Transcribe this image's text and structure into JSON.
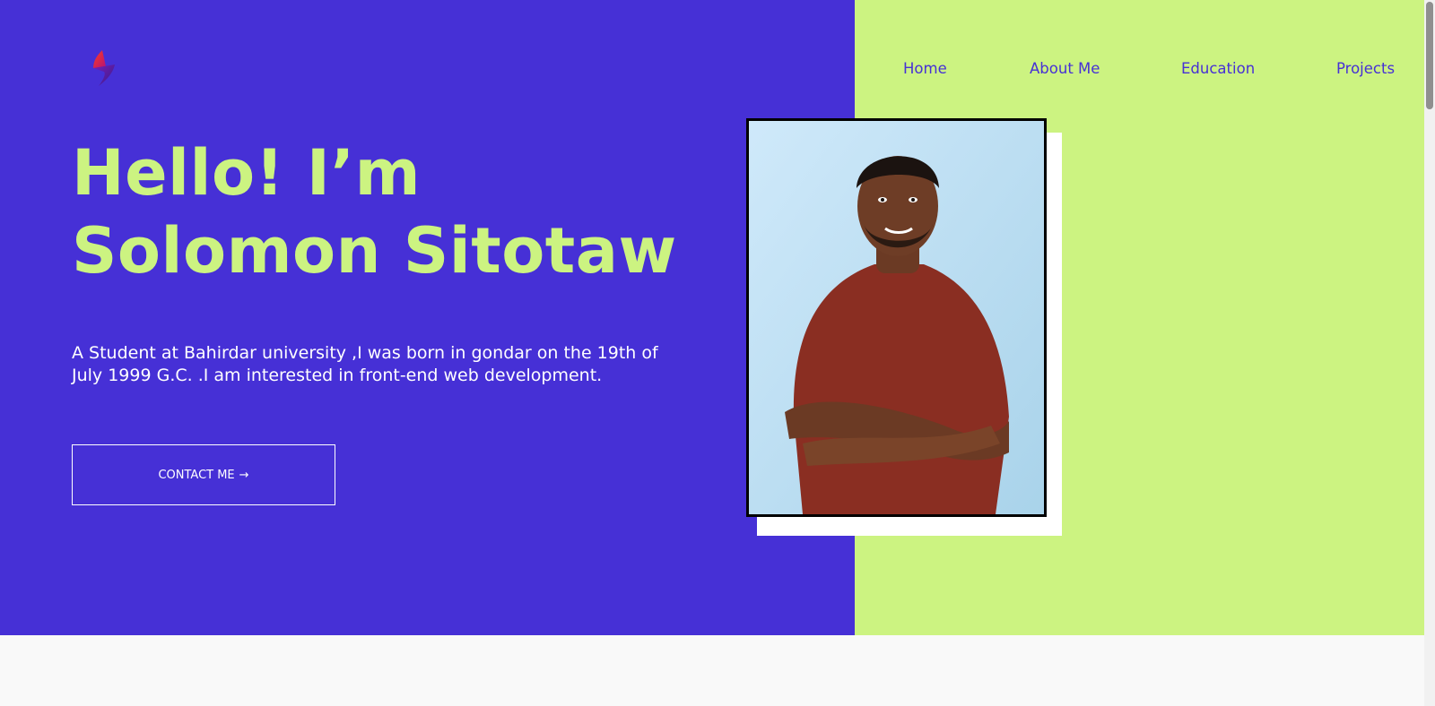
{
  "nav": {
    "items": [
      {
        "label": "Home"
      },
      {
        "label": "About Me"
      },
      {
        "label": "Education"
      },
      {
        "label": "Projects"
      }
    ]
  },
  "hero": {
    "headline_line1": "Hello! I’m",
    "headline_line2": "Solomon Sitotaw",
    "bio": "A Student at Bahirdar university ,I was born in gondar on the 19th of July 1999 G.C. .I am interested in front-end web development.",
    "cta_label": "CONTACT ME",
    "cta_icon": "→"
  },
  "colors": {
    "primary": "#4630d6",
    "accent": "#ccf381",
    "background": "#f9f9f9"
  },
  "icons": {
    "logo": "logo-icon",
    "cta": "arrow-right-icon"
  },
  "photo": {
    "subject": "portrait-photo"
  }
}
